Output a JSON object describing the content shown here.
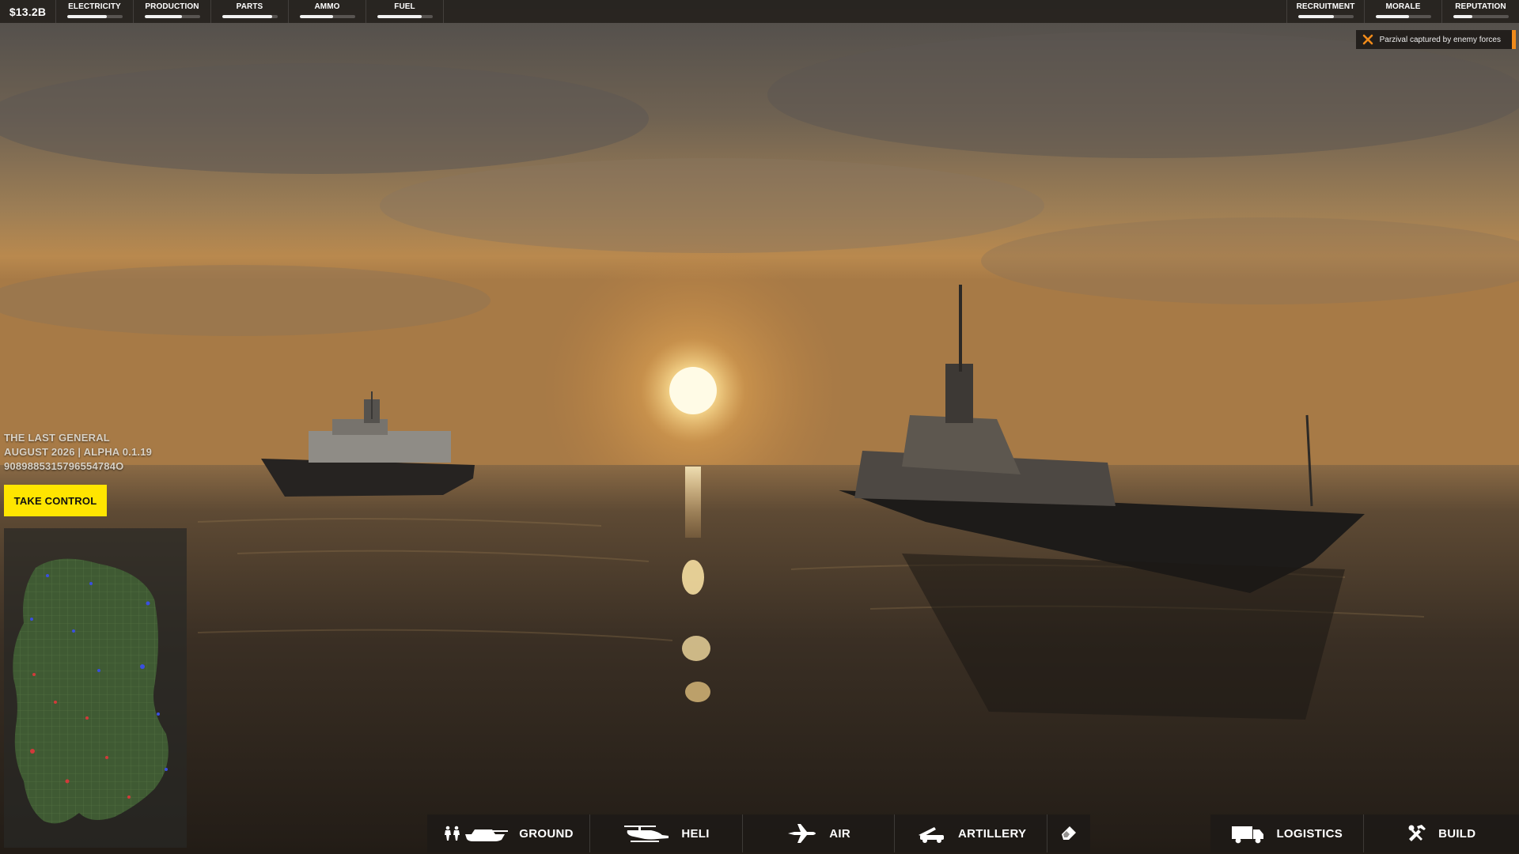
{
  "hud": {
    "money": "$13.2B",
    "resources_left": [
      {
        "label": "ELECTRICITY",
        "level": 0.72
      },
      {
        "label": "PRODUCTION",
        "level": 0.68
      },
      {
        "label": "PARTS",
        "level": 0.9
      },
      {
        "label": "AMMO",
        "level": 0.6
      },
      {
        "label": "FUEL",
        "level": 0.8
      }
    ],
    "resources_right": [
      {
        "label": "RECRUITMENT",
        "level": 0.65
      },
      {
        "label": "MORALE",
        "level": 0.6
      },
      {
        "label": "REPUTATION",
        "level": 0.35
      }
    ]
  },
  "notification": {
    "text": "Parzival captured by enemy forces",
    "icon": "close-x-icon",
    "accent": "#f08a1a"
  },
  "game_info": {
    "title": "THE LAST GENERAL",
    "version": "AUGUST 2026 | ALPHA 0.1.19",
    "seed": "9089885315796554784O"
  },
  "take_control_label": "TAKE CONTROL",
  "bottom_tabs": [
    {
      "label": "GROUND",
      "icon": "soldiers-tank-icon"
    },
    {
      "label": "HELI",
      "icon": "helicopter-icon"
    },
    {
      "label": "AIR",
      "icon": "jet-icon"
    },
    {
      "label": "ARTILLERY",
      "icon": "artillery-icon"
    },
    {
      "label": "",
      "icon": "eraser-icon"
    }
  ],
  "bottom_tabs_right": [
    {
      "label": "LOGISTICS",
      "icon": "truck-icon"
    },
    {
      "label": "BUILD",
      "icon": "hammer-wrench-icon"
    }
  ],
  "colors": {
    "accent_yellow": "#ffe500",
    "notification_orange": "#f08a1a"
  }
}
